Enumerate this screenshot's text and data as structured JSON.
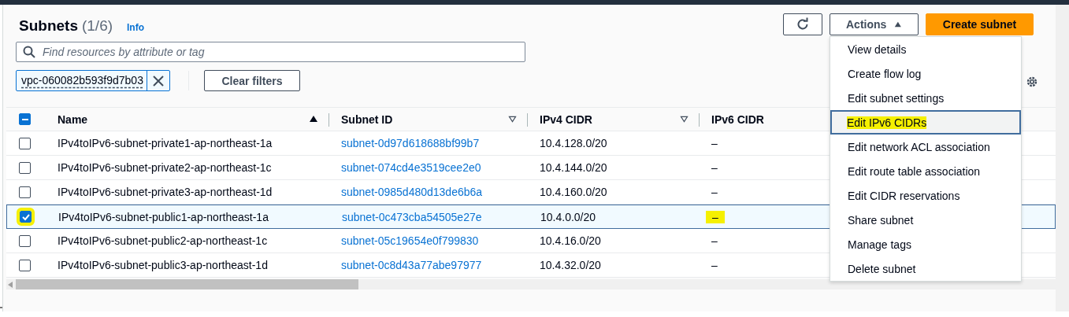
{
  "header": {
    "title": "Subnets",
    "count": "(1/6)",
    "info_link": "Info"
  },
  "toolbar": {
    "actions_label": "Actions",
    "actions_expanded": true,
    "create_label": "Create subnet"
  },
  "search": {
    "placeholder": "Find resources by attribute or tag"
  },
  "filter_token": "vpc-060082b593f9d7b03",
  "clear_filters": "Clear filters",
  "table": {
    "header_checkbox_indeterminate": true,
    "columns": [
      {
        "label": "Name",
        "sortable": true,
        "sorted_ascending": true
      },
      {
        "label": "Subnet ID",
        "sortable": true,
        "sorted_ascending": false
      },
      {
        "label": "IPv4 CIDR",
        "sortable": true,
        "sorted_ascending": false
      },
      {
        "label": "IPv6 CIDR"
      }
    ],
    "rows": [
      {
        "name": "IPv4toIPv6-subnet-private1-ap-northeast-1a",
        "subnet_id": "subnet-0d97d618688bf99b7",
        "ipv4": "10.4.128.0/20",
        "ipv6": "–",
        "selected": false,
        "highlighted": false
      },
      {
        "name": "IPv4toIPv6-subnet-private2-ap-northeast-1c",
        "subnet_id": "subnet-074cd4e3519cee2e0",
        "ipv4": "10.4.144.0/20",
        "ipv6": "–",
        "selected": false,
        "highlighted": false
      },
      {
        "name": "IPv4toIPv6-subnet-private3-ap-northeast-1d",
        "subnet_id": "subnet-0985d480d13de6b6a",
        "ipv4": "10.4.160.0/20",
        "ipv6": "–",
        "selected": false,
        "highlighted": false
      },
      {
        "name": "IPv4toIPv6-subnet-public1-ap-northeast-1a",
        "subnet_id": "subnet-0c473cba54505e27e",
        "ipv4": "10.4.0.0/20",
        "ipv6": "–",
        "selected": true,
        "highlighted": true
      },
      {
        "name": "IPv4toIPv6-subnet-public2-ap-northeast-1c",
        "subnet_id": "subnet-05c19654e0f799830",
        "ipv4": "10.4.16.0/20",
        "ipv6": "–",
        "selected": false,
        "highlighted": false
      },
      {
        "name": "IPv4toIPv6-subnet-public3-ap-northeast-1d",
        "subnet_id": "subnet-0c8d43a77abe97977",
        "ipv4": "10.4.32.0/20",
        "ipv6": "–",
        "selected": false,
        "highlighted": false
      }
    ]
  },
  "actions_menu": [
    {
      "label": "View details",
      "focused": false,
      "highlighted": false
    },
    {
      "label": "Create flow log",
      "focused": false,
      "highlighted": false
    },
    {
      "label": "Edit subnet settings",
      "focused": false,
      "highlighted": false
    },
    {
      "label": "Edit IPv6 CIDRs",
      "focused": true,
      "highlighted": true
    },
    {
      "label": "Edit network ACL association",
      "focused": false,
      "highlighted": false
    },
    {
      "label": "Edit route table association",
      "focused": false,
      "highlighted": false
    },
    {
      "label": "Edit CIDR reservations",
      "focused": false,
      "highlighted": false
    },
    {
      "label": "Share subnet",
      "focused": false,
      "highlighted": false
    },
    {
      "label": "Manage tags",
      "focused": false,
      "highlighted": false
    },
    {
      "label": "Delete subnet",
      "focused": false,
      "highlighted": false
    }
  ]
}
